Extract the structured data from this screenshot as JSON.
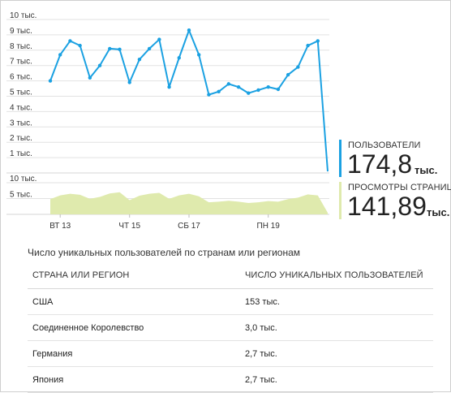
{
  "chart_data": [
    {
      "type": "line",
      "y_ticks": [
        "1 тыс.",
        "2 тыс.",
        "3 тыс.",
        "4 тыс.",
        "5 тыс.",
        "6 тыс.",
        "7 тыс.",
        "8 тыс.",
        "9 тыс.",
        "10 тыс."
      ],
      "ylim": [
        0,
        10000
      ],
      "x": [
        0,
        1,
        2,
        3,
        4,
        5,
        6,
        7,
        8,
        9,
        10,
        11,
        12,
        13,
        14,
        15,
        16,
        17,
        18,
        19,
        20,
        21,
        22,
        23,
        24,
        25,
        26,
        27,
        28
      ],
      "series": [
        {
          "color": "#1ba1e2",
          "values": [
            6000,
            7700,
            8600,
            8300,
            6200,
            7000,
            8100,
            8050,
            5900,
            7400,
            8100,
            8700,
            5600,
            7500,
            9300,
            7700,
            5100,
            5300,
            5800,
            5600,
            5200,
            5400,
            5600,
            5450,
            6400,
            6900,
            8300,
            8600,
            100
          ]
        }
      ],
      "grid": true
    },
    {
      "type": "area",
      "y_ticks": [
        "5 тыс.",
        "10 тыс."
      ],
      "ylim": [
        0,
        10000
      ],
      "x_ticks": [
        {
          "label": "ВТ 13",
          "at": 1
        },
        {
          "label": "ЧТ 15",
          "at": 8
        },
        {
          "label": "СБ 17",
          "at": 14
        },
        {
          "label": "ПН 19",
          "at": 22
        }
      ],
      "series": [
        {
          "color": "#dfeaad",
          "values": [
            4800,
            6000,
            6500,
            6200,
            4900,
            5500,
            6600,
            7000,
            4500,
            5900,
            6500,
            6800,
            4900,
            6000,
            6500,
            5700,
            3800,
            4000,
            4300,
            4000,
            3600,
            3800,
            4200,
            4000,
            4800,
            5300,
            6300,
            6000,
            500
          ]
        }
      ]
    }
  ],
  "metrics": {
    "users": {
      "label": "ПОЛЬЗОВАТЕЛИ",
      "value": "174,8",
      "unit": "тыс.",
      "color": "#1ba1e2"
    },
    "pageviews": {
      "label": "ПРОСМОТРЫ СТРАНИЦ",
      "value": "141,89",
      "unit": "тыс.",
      "color": "#dfeaad"
    }
  },
  "table": {
    "title": "Число уникальных пользователей по странам или регионам",
    "headers": [
      "СТРАНА ИЛИ РЕГИОН",
      "ЧИСЛО УНИКАЛЬНЫХ ПОЛЬЗОВАТЕЛЕЙ"
    ],
    "rows": [
      [
        "США",
        "153 тыс."
      ],
      [
        "Соединенное Королевство",
        "3,0 тыс."
      ],
      [
        "Германия",
        "2,7 тыс."
      ],
      [
        "Япония",
        "2,7 тыс."
      ]
    ]
  }
}
